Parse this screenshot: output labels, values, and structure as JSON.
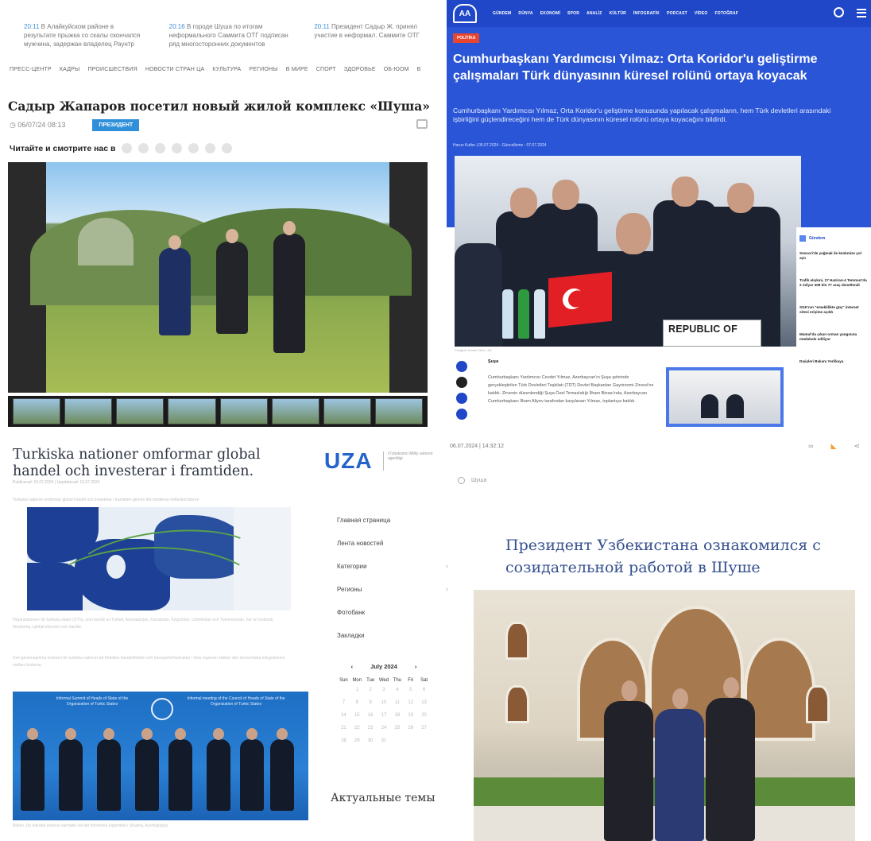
{
  "kg": {
    "ticker": [
      {
        "time": "20:11",
        "text": "В Алайкуйском районе в результате прыжка со скалы скончался мужчина, задержан владелец Раунтр"
      },
      {
        "time": "20:16",
        "text": "В городе Шуша по итогам неформального Саммита ОТГ подписан ряд многосторонних документов"
      },
      {
        "time": "20:11",
        "text": "Президент Садыр Ж. принял участие в неформал. Саммите ОТГ"
      }
    ],
    "nav": [
      "ПРЕСС-ЦЕНТР",
      "КАДРЫ",
      "ПРОИСШЕСТВИЯ",
      "НОВОСТИ СТРАН ЦА",
      "КУЛЬТУРА",
      "РЕГИОНЫ",
      "В МИРЕ",
      "СПОРТ",
      "ЗДОРОВЬЕ",
      "ОБ-ЮОМ",
      "В"
    ],
    "title": "Садыр Жапаров посетил новый жилой комплекс «Шуша»",
    "datetime": "06/07/24 08:13",
    "badge": "ПРЕЗИДЕНТ",
    "share_label": "Читайте и смотрите нас в"
  },
  "aa": {
    "logo": "AA",
    "nav": [
      "GÜNDEM",
      "DÜNYA",
      "EKONOMİ",
      "SPOR",
      "ANALİZ",
      "KÜLTÜR",
      "İNFOGRAFİK",
      "PODCAST",
      "VİDEO",
      "FOTOĞRAF"
    ],
    "badge": "POLİTİKA",
    "title": "Cumhurbaşkanı Yardımcısı Yılmaz: Orta Koridor'u geliştirme çalışmaları Türk dünyasının küresel rolünü ortaya koyacak",
    "lead": "Cumhurbaşkanı Yardımcısı Yılmaz, Orta Koridor'u geliştirme konusunda yapılacak çalışmaların, hem Türk devletleri arasındaki işbirliğini güçlendireceğini hem de Türk dünyasının küresel rolünü ortaya koyacağını bildirdi.",
    "meta": "Harun Kutbe | 06.07.2024 - Güncelleme : 07.07.2024",
    "placard": "REPUBLIC OF",
    "caption": "Fotoğraf: Ahmet Okur / AA",
    "body_head": "Şuşa",
    "body": "Cumhurbaşkanı Yardımcısı Cevdet Yılmaz, Azerbaycan'ın Şuşa şehrinde gerçekleştirilen Türk Devletleri Teşkilatı (TDT) Devlet Başkanları Gayriresmi Zirvesi'ne katıldı. Zirvenin düzenlendiği Şuşa Özel Temaslıdığı İlham Binası'nda, Azerbaycan Cumhurbaşkanı İlham Aliyev tarafından karşılanan Yılmaz, toplantıya katıldı.",
    "sidebar_title": "Gündem",
    "sidebar": [
      "Sensori'de yağmak ile kenkmize yol açtı",
      "Trafik alışkıni, 27 Haziran-4 Temmuz'da 2 milyar 408 bin 77 araç denetlendi",
      "SGK'nın \"emeklilikte güç\" internet sitesi erişime açıldı",
      "Mamul'da çıkan orman yangınına müdahale ediliyor",
      "Dışişleri Bakanı Yerlikaya"
    ]
  },
  "sw": {
    "title": "Turkiska nationer omformar global handel och investerar i framtiden.",
    "sub": "Publicerad: 10.07.2024 | Uppdaterad: 10.07.2024",
    "lead": "Turkiska nationer omformar global handel och investerar i framtiden genom det moderna mellankorridoren",
    "para1": "Organisationen för turkiska stater (OTS), som består av Turkiet, Azerbajdzjan, Kazakstan, Kirgizistan, Uzbekistan och Turkmenistan, har en historisk förankring i global ekonomi och handel.",
    "para2": "Den gemensamma visionen för turkiska nationer att förbättra handelsflöden och transportinfrastruktur i hela regionen stärker den ekonomiska integrationen mellan länderna.",
    "banner_left": "Informal Summit of Heads of State of the Organization of Turkic States",
    "banner_right": "Informal meeting of the Council of Heads of State of the Organization of Turkic States",
    "foot": "Bilden: De turkiska ledarna samlade vid det informella toppmötet i Shusha, Azerbajdzjan."
  },
  "uza": {
    "logo": "UZA",
    "tagline": "O'zbekiston Milliy axborot agentligi",
    "date": "06.07.2024 | 14:32:12",
    "search": "Шуша",
    "menu": [
      {
        "label": "Главная страница",
        "arrow": false
      },
      {
        "label": "Лента новостей",
        "arrow": false
      },
      {
        "label": "Категории",
        "arrow": true
      },
      {
        "label": "Регионы",
        "arrow": true
      },
      {
        "label": "Фотобанк",
        "arrow": false
      },
      {
        "label": "Закладки",
        "arrow": false
      }
    ],
    "calendar": {
      "month": "July 2024",
      "days": [
        "Sun",
        "Mon",
        "Tue",
        "Wed",
        "Thu",
        "Fri",
        "Sat"
      ],
      "dates": [
        "",
        "1",
        "2",
        "3",
        "4",
        "5",
        "6",
        "7",
        "8",
        "9",
        "10",
        "11",
        "12",
        "13",
        "14",
        "15",
        "16",
        "17",
        "18",
        "19",
        "20",
        "21",
        "22",
        "23",
        "24",
        "25",
        "26",
        "27",
        "28",
        "29",
        "30",
        "31"
      ]
    },
    "topics": "Актуальные темы",
    "title": "Президент Узбекистана ознакомился с созидательной работой в Шуше"
  }
}
